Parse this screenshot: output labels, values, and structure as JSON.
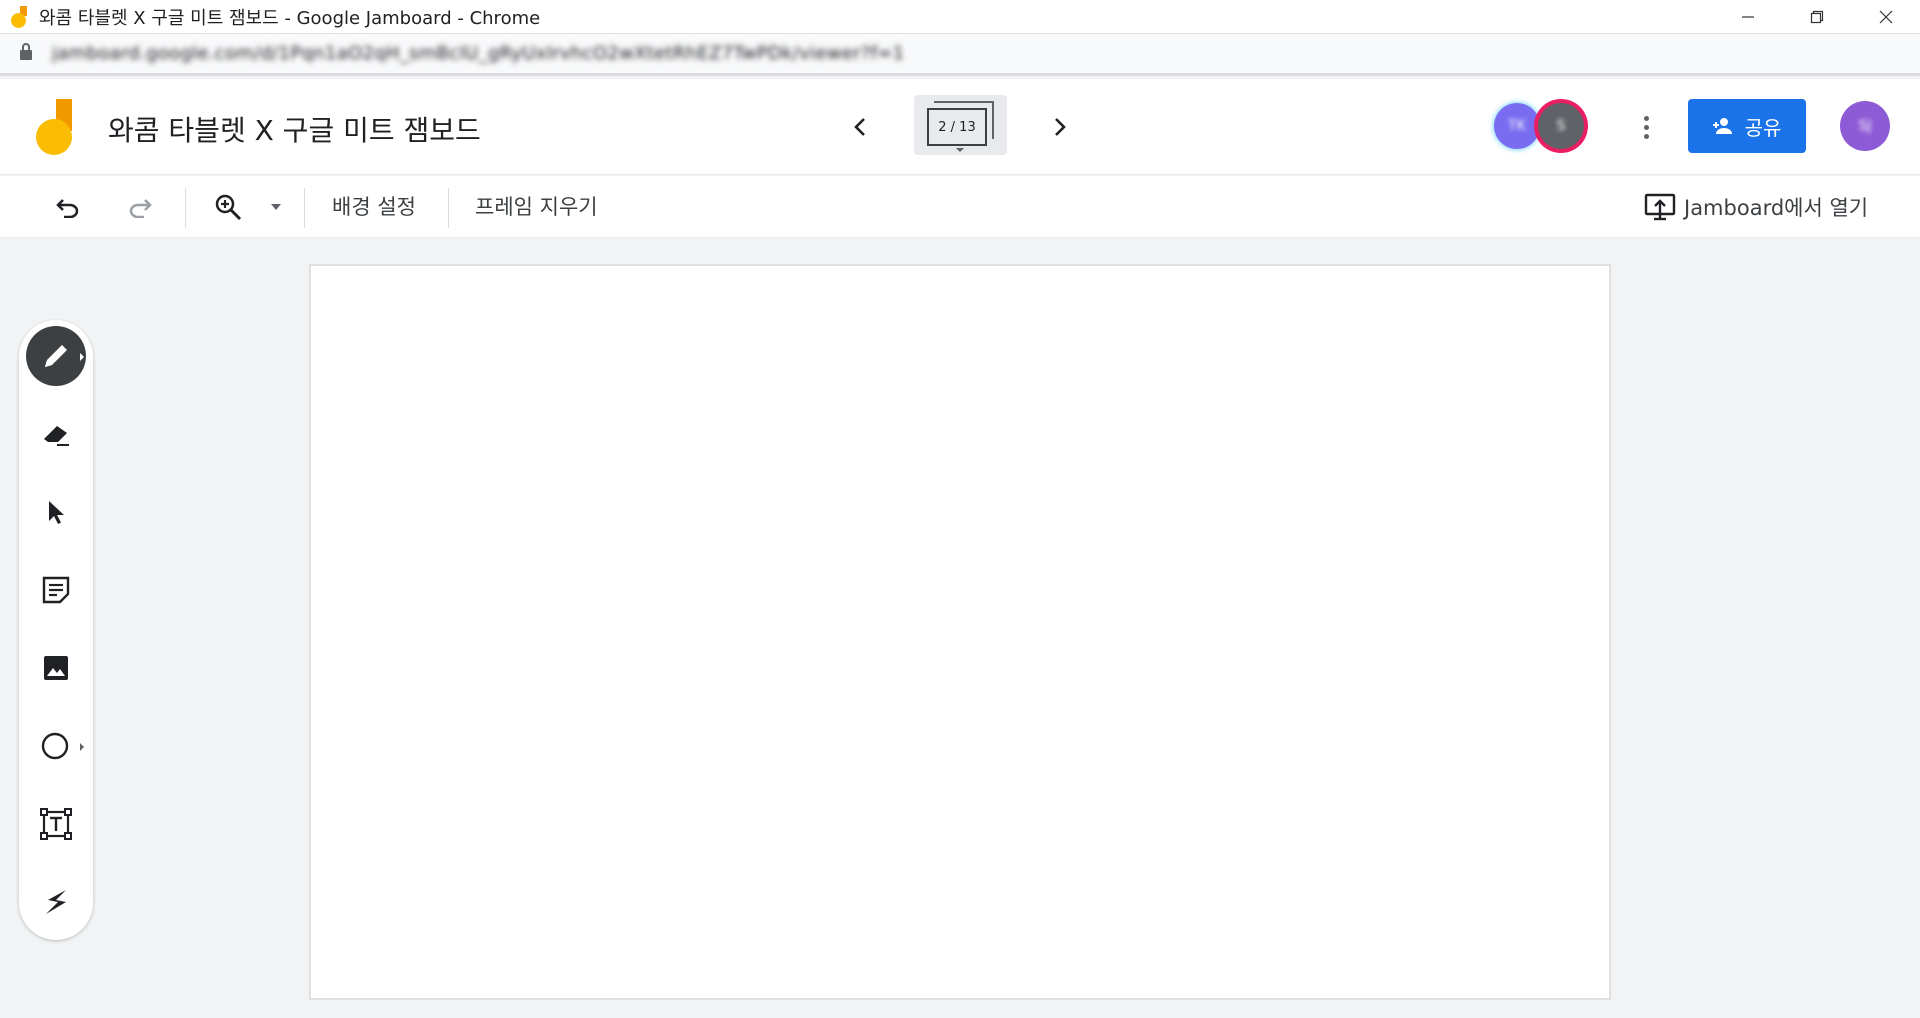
{
  "window": {
    "title": "와콤 타블렛 X 구글 미트 잼보드 - Google Jamboard - Chrome",
    "controls": [
      "minimize",
      "restore",
      "close"
    ]
  },
  "address_bar": {
    "url": "jamboard.google.com/d/1Pqn1aO2qH_smBcIU_gRyUxIrvhcO2wXtetRhEZ7TwPDk/viewer?f=1"
  },
  "header": {
    "doc_title": "와콤 타블렛 X 구글 미트 잼보드",
    "frame_counter": "2 / 13",
    "prev_icon": "chevron-left-icon",
    "next_icon": "chevron-right-icon",
    "collaborators": [
      {
        "initials": "TK",
        "color": "#7a6cf0"
      },
      {
        "initials": "S",
        "color": "#5f6368"
      }
    ],
    "share_label": "공유",
    "user_initials": "SJ",
    "user_color": "#8e5bd6"
  },
  "toolbar": {
    "undo_icon": "undo-icon",
    "redo_icon": "redo-icon",
    "zoom_icon": "zoom-in-icon",
    "background_label": "배경 설정",
    "clear_frame_label": "프레임 지우기",
    "open_in_jamboard_label": "Jamboard에서 열기"
  },
  "tools": [
    {
      "name": "pen-icon",
      "active": true
    },
    {
      "name": "eraser-icon",
      "active": false
    },
    {
      "name": "select-arrow-icon",
      "active": false
    },
    {
      "name": "sticky-note-icon",
      "active": false
    },
    {
      "name": "image-icon",
      "active": false
    },
    {
      "name": "circle-shape-icon",
      "active": false
    },
    {
      "name": "text-box-icon",
      "active": false
    },
    {
      "name": "laser-icon",
      "active": false
    }
  ],
  "colors": {
    "accent": "#1a73e8",
    "active_tool": "#3c4043",
    "logo_orange": "#f29900",
    "logo_yellow": "#fbbc04"
  }
}
